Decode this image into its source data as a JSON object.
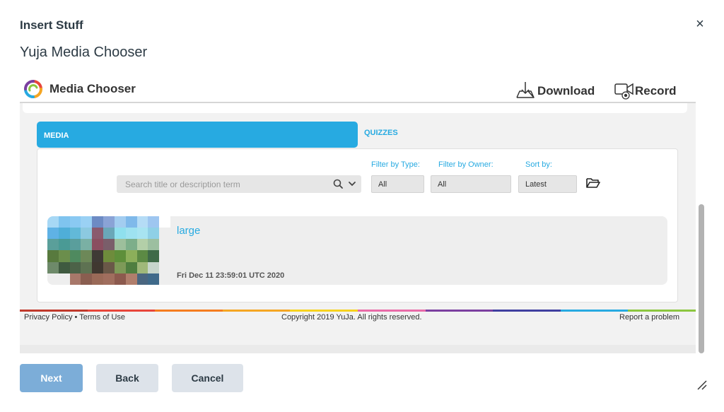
{
  "dialog": {
    "title": "Insert Stuff",
    "close_label": "×",
    "section_title": "Yuja Media Chooser"
  },
  "chooser": {
    "header_title": "Media Chooser",
    "download_label": "Download",
    "record_label": "Record",
    "tabs": [
      {
        "label": "MEDIA",
        "active": true
      },
      {
        "label": "QUIZZES",
        "active": false
      }
    ],
    "search": {
      "placeholder": "Search title or description term"
    },
    "filters": {
      "type_label": "Filter by Type:",
      "type_value": "All",
      "owner_label": "Filter by Owner:",
      "owner_value": "All",
      "sort_label": "Sort by:",
      "sort_value": "Latest"
    },
    "items": [
      {
        "title": "large",
        "date": "Fri Dec 11 23:59:01 UTC 2020"
      }
    ],
    "footer": {
      "privacy": "Privacy Policy",
      "separator": " • ",
      "terms": "Terms of Use",
      "copyright": "Copyright 2019 YuJa. All rights reserved.",
      "report": "Report a problem"
    }
  },
  "buttons": {
    "next": "Next",
    "back": "Back",
    "cancel": "Cancel"
  },
  "colors": {
    "accent": "#27aae1",
    "next_button": "#7cadd8",
    "secondary_button": "#dde3ea",
    "text": "#2d3b45"
  },
  "icons": [
    "logo-icon",
    "download-icon",
    "record-icon",
    "search-icon",
    "chevron-down-icon",
    "folder-icon",
    "close-icon",
    "resize-grip-icon"
  ]
}
